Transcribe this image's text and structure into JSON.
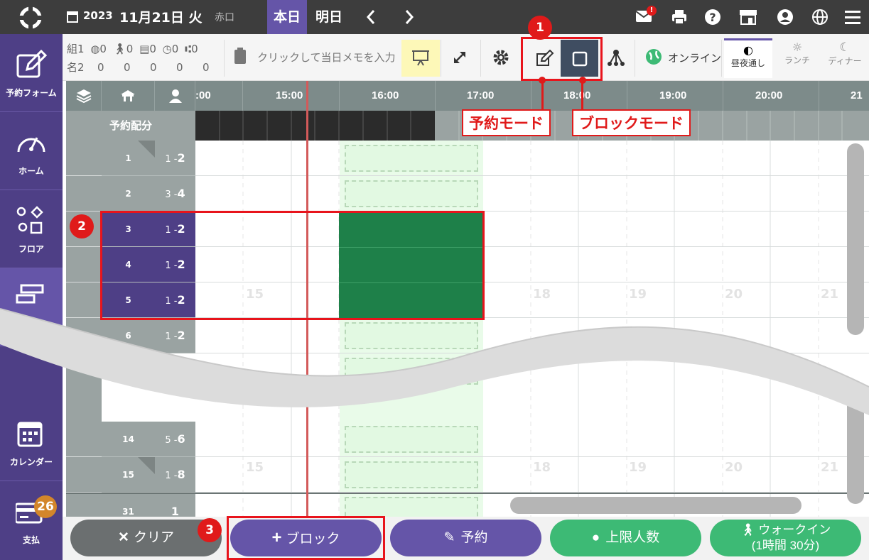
{
  "header": {
    "year": "2023",
    "date": "11月21日 火",
    "rokuyo": "赤口",
    "today": "本日",
    "tomorrow": "明日",
    "mail_badge": "!"
  },
  "sidebar": {
    "items": [
      {
        "label": "予約フォーム"
      },
      {
        "label": "ホーム"
      },
      {
        "label": "フロア"
      },
      {
        "label": "カレンダー"
      },
      {
        "label": "支払",
        "badge": "26"
      }
    ]
  },
  "toolbar": {
    "stats_top": "組1 0 0 0 0 0",
    "stats_bottom": "名2 0 0 0 0 0",
    "stats_top_values": [
      "組1",
      "0",
      "0",
      "0",
      "0",
      "0"
    ],
    "stats_bottom_values": [
      "名2",
      "0",
      "0",
      "0",
      "0",
      "0"
    ],
    "memo_placeholder": "クリックして当日メモを入力",
    "online_label": "オンライン",
    "mode_all": "昼夜通し",
    "mode_lunch": "ランチ",
    "mode_dinner": "ディナー"
  },
  "grid": {
    "allocation_label": "予約配分",
    "hours": [
      ":00",
      "15:00",
      "16:00",
      "17:00",
      "18:00",
      "19:00",
      "20:00",
      "21"
    ],
    "rows_top": [
      {
        "table": "1",
        "cap_pre": "1 -",
        "cap_max": "2"
      },
      {
        "table": "2",
        "cap_pre": "3 -",
        "cap_max": "4"
      },
      {
        "table": "3",
        "cap_pre": "1 -",
        "cap_max": "2"
      },
      {
        "table": "4",
        "cap_pre": "1 -",
        "cap_max": "2"
      },
      {
        "table": "5",
        "cap_pre": "1 -",
        "cap_max": "2"
      },
      {
        "table": "6",
        "cap_pre": "1 -",
        "cap_max": "2"
      }
    ],
    "rows_bottom": [
      {
        "table": "14",
        "cap_pre": "5 -",
        "cap_max": "6"
      },
      {
        "table": "15",
        "cap_pre": "1 -",
        "cap_max": "8"
      },
      {
        "table": "31",
        "cap_pre": "",
        "cap_max": "1"
      }
    ],
    "bg_hour_nums": [
      "15",
      "18",
      "19",
      "20",
      "21"
    ]
  },
  "annotations": {
    "n1": "1",
    "n2": "2",
    "n3": "3",
    "reserve_mode": "予約モード",
    "block_mode": "ブロックモード"
  },
  "bottom_buttons": {
    "clear": "クリア",
    "block": "ブロック",
    "reserve": "予約",
    "limit": "上限人数",
    "walkin_1": "ウォークイン",
    "walkin_2": "(1時間 30分)"
  },
  "colors": {
    "purple": "#4e3f86",
    "green_block": "#1e8049",
    "accent_red": "#e01a1a",
    "green_btn": "#3dba75"
  }
}
